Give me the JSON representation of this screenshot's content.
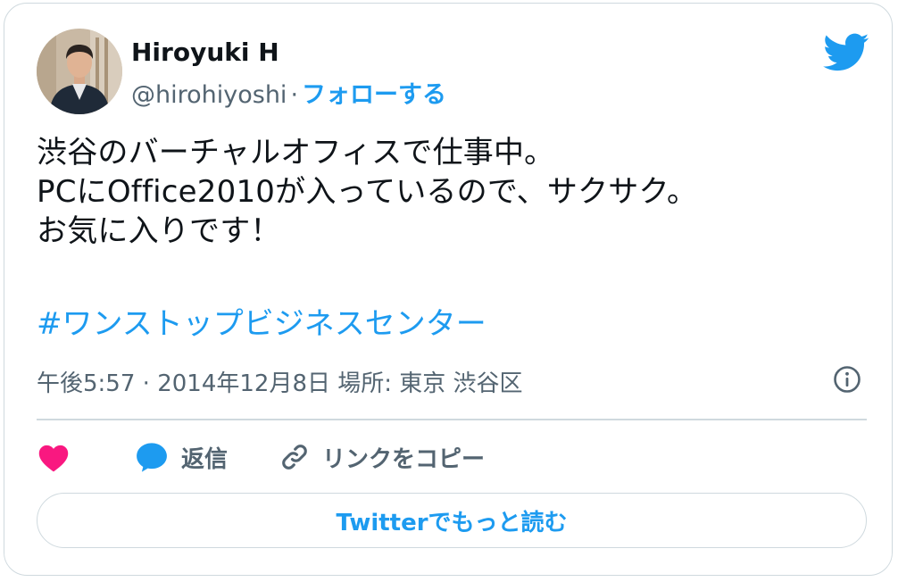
{
  "user": {
    "name": "Hiroyuki H",
    "handle": "@hirohiyoshi",
    "separator": "·",
    "follow_label": "フォローする"
  },
  "tweet": {
    "lines": [
      "渋谷のバーチャルオフィスで仕事中。",
      "PCにOffice2010が入っているので、サクサク。",
      "お気に入りです！"
    ],
    "hashtag": "#ワンストップビジネスセンター"
  },
  "meta": {
    "time": "午後5:57",
    "separator": "·",
    "date": "2014年12月8日",
    "location_label": "場所:",
    "location": "東京 渋谷区"
  },
  "actions": {
    "like_icon": "heart-icon",
    "reply_label": "返信",
    "copy_link_label": "リンクをコピー"
  },
  "read_more_label": "Twitterでもっと読む",
  "colors": {
    "brand": "#1d9bf0",
    "like": "#f91880",
    "muted": "#536471",
    "border": "#cfd9de"
  }
}
